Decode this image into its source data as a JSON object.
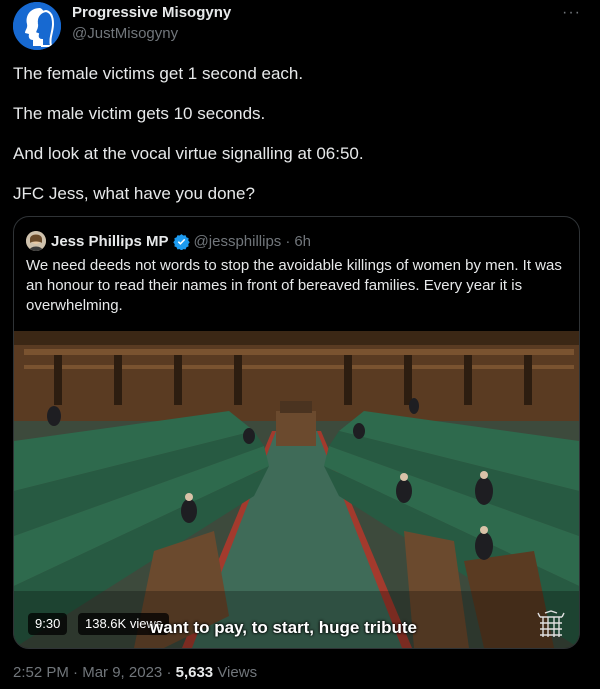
{
  "author": {
    "name": "Progressive Misogyny",
    "handle": "@JustMisogyny"
  },
  "more_label": "···",
  "tweet": {
    "paragraphs": [
      "The female victims get 1 second each.",
      "The male victim gets 10 seconds.",
      "And look at the vocal virtue signalling at 06:50.",
      "JFC Jess, what have you done?"
    ]
  },
  "quote": {
    "name": "Jess Phillips MP",
    "handle": "@jessphillips",
    "separator": "·",
    "age": "6h",
    "text": "We need deeds not words to stop the avoidable killings of women by men. It was an honour to read their names in front of bereaved families. Every year it is overwhelming.",
    "video": {
      "duration": "9:30",
      "views": "138.6K views",
      "caption": "want to pay, to start, huge tribute"
    }
  },
  "footer": {
    "time": "2:52 PM",
    "separator": "·",
    "date": "Mar 9, 2023",
    "views_count": "5,633",
    "views_label": "Views"
  },
  "colors": {
    "background": "#000000",
    "text": "#e7e9ea",
    "secondary": "#71767b",
    "border": "#2f3336",
    "verified": "#1d9bf0",
    "bench_green": "#2e6a4d",
    "wood": "#6b4a2e"
  },
  "icons": {
    "avatar": "women-silhouettes-avatar",
    "verified": "verified-badge-icon",
    "parliament": "portcullis-icon"
  }
}
